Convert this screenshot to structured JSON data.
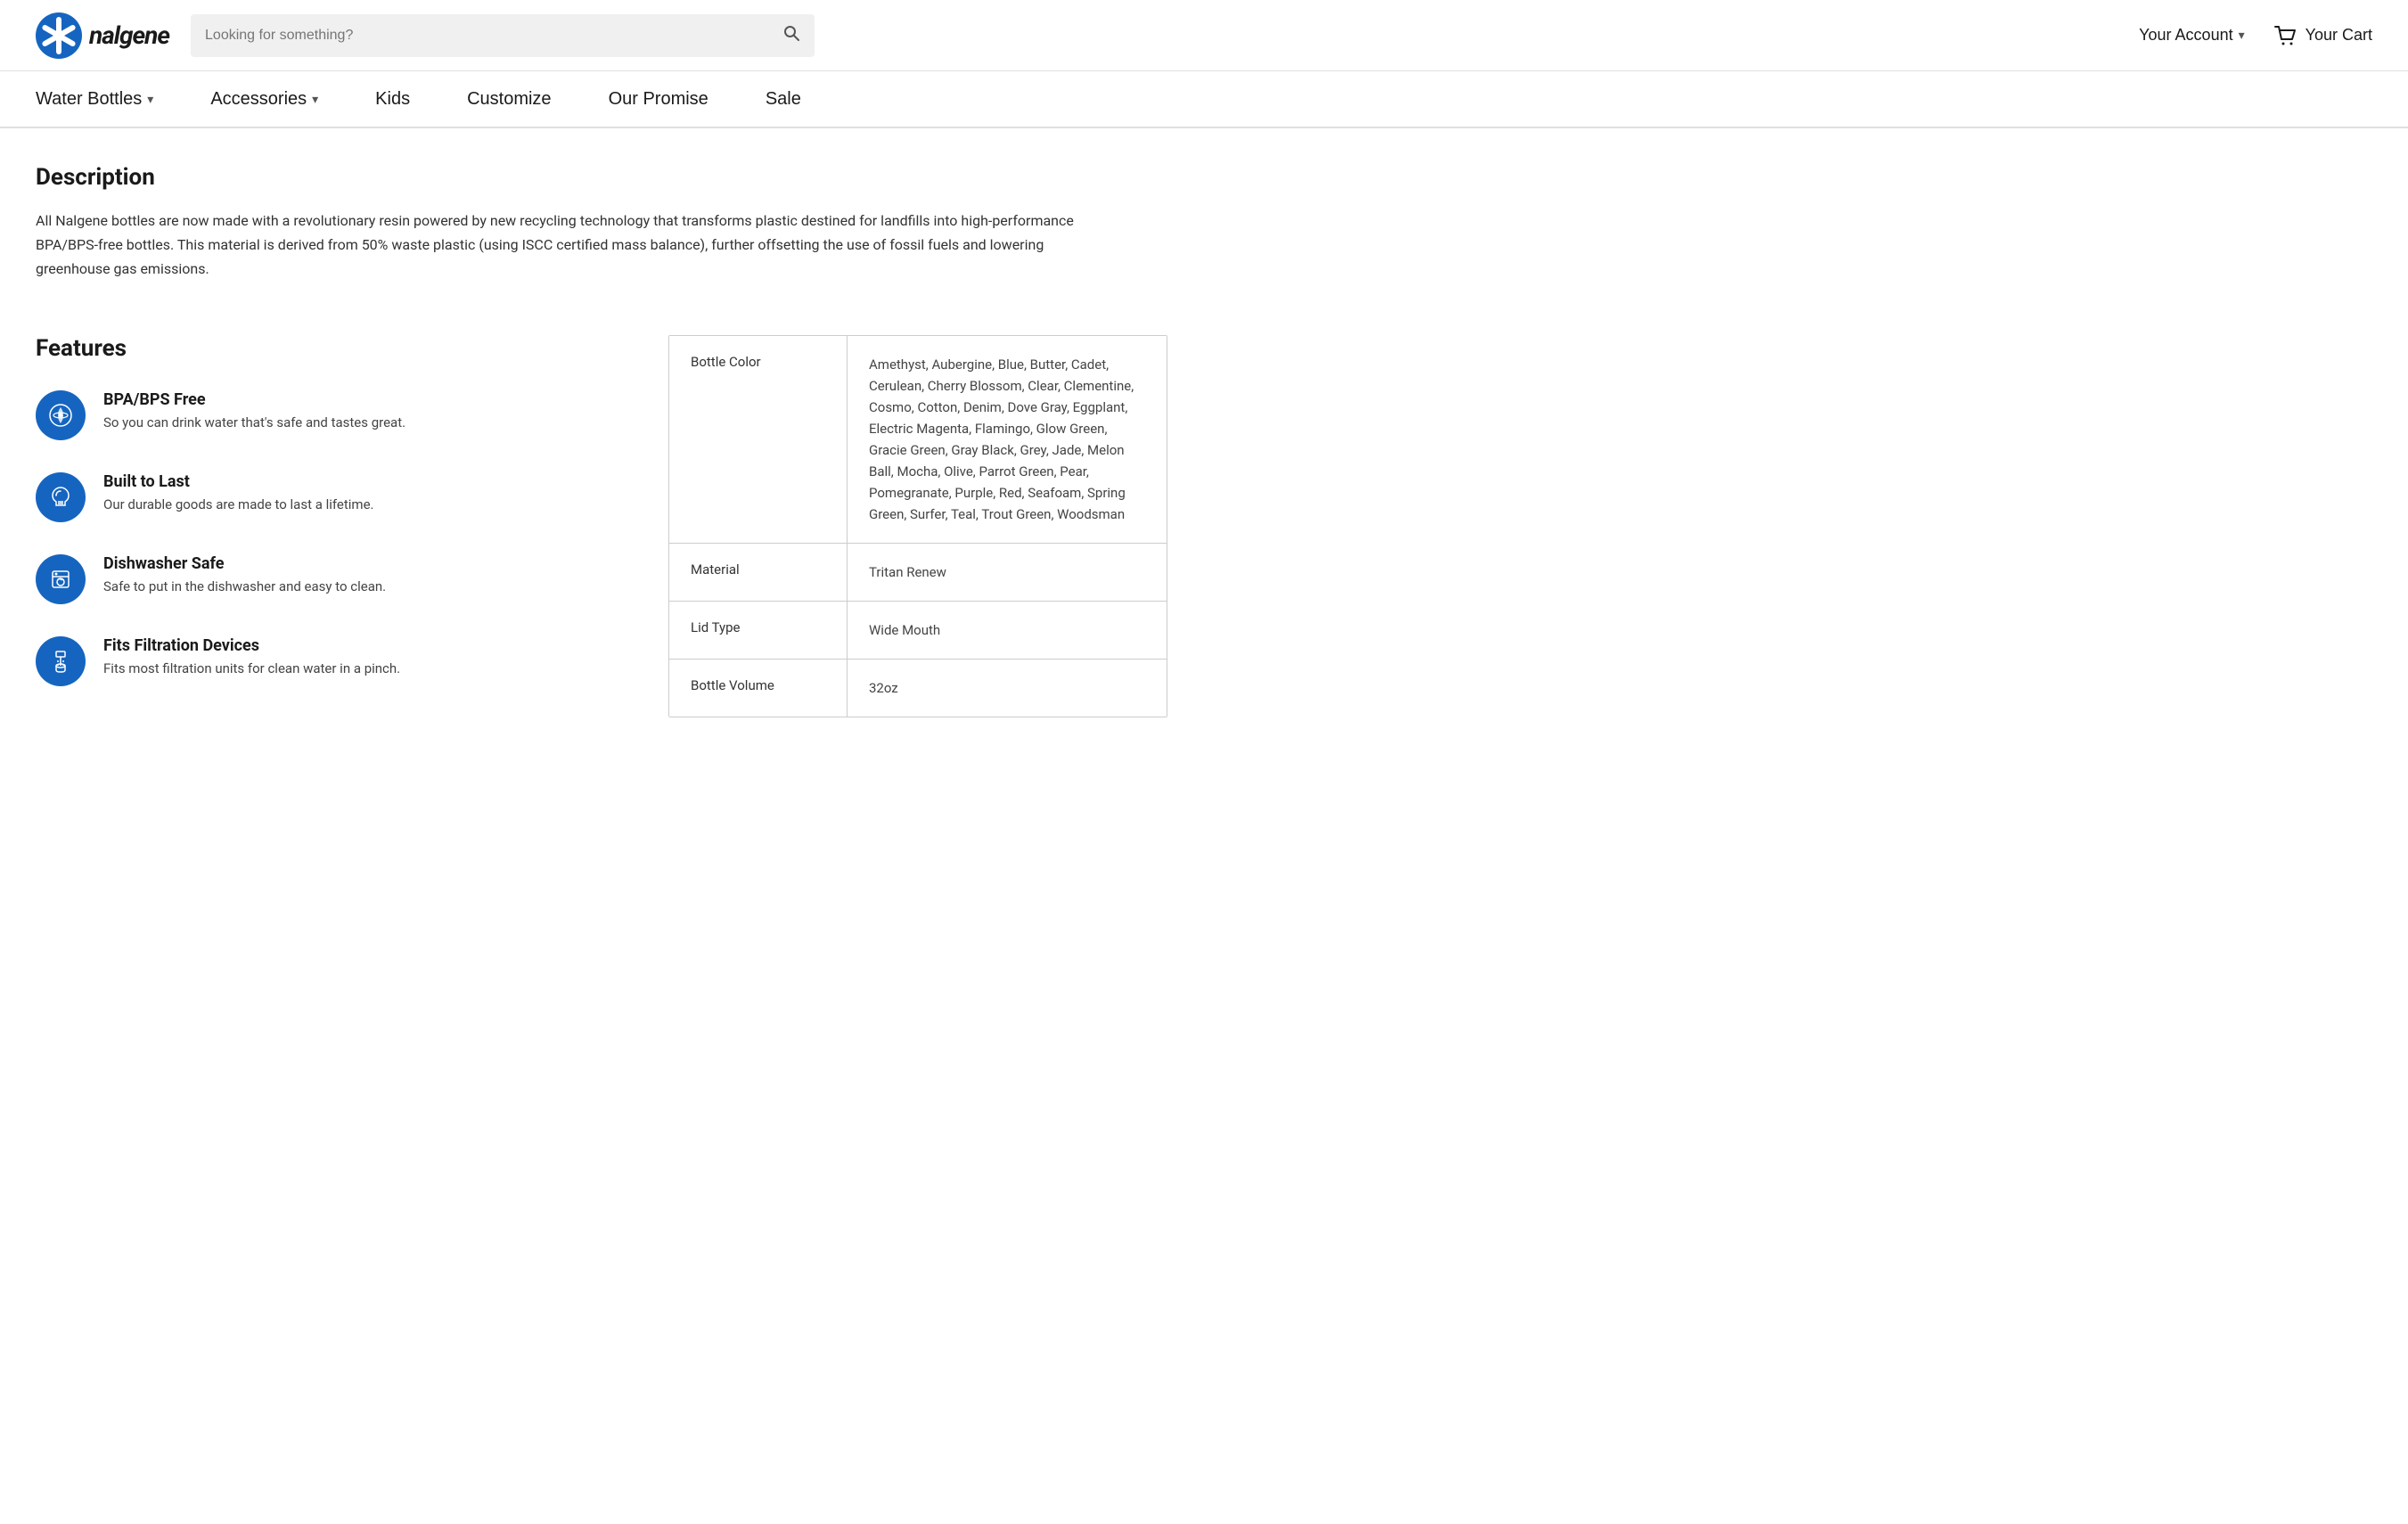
{
  "header": {
    "logo_text": "nalgene",
    "search_placeholder": "Looking for something?",
    "account_label": "Your Account",
    "cart_label": "Your Cart"
  },
  "nav": {
    "items": [
      {
        "label": "Water Bottles",
        "has_dropdown": true
      },
      {
        "label": "Accessories",
        "has_dropdown": true
      },
      {
        "label": "Kids",
        "has_dropdown": false
      },
      {
        "label": "Customize",
        "has_dropdown": false
      },
      {
        "label": "Our Promise",
        "has_dropdown": false
      },
      {
        "label": "Sale",
        "has_dropdown": false
      }
    ]
  },
  "description": {
    "title": "Description",
    "text": "All Nalgene bottles are now made with a revolutionary resin powered by new recycling technology that transforms plastic destined for landfills into high-performance BPA/BPS-free bottles. This material is derived from 50% waste plastic (using ISCC certified mass balance), further offsetting the use of fossil fuels and lowering greenhouse gas emissions."
  },
  "features": {
    "title": "Features",
    "items": [
      {
        "id": "bpa-bps-free",
        "name": "BPA/BPS Free",
        "description": "So you can drink water that's safe and tastes great."
      },
      {
        "id": "built-to-last",
        "name": "Built to Last",
        "description": "Our durable goods are made to last a lifetime."
      },
      {
        "id": "dishwasher-safe",
        "name": "Dishwasher Safe",
        "description": "Safe to put in the dishwasher and easy to clean."
      },
      {
        "id": "fits-filtration",
        "name": "Fits Filtration Devices",
        "description": "Fits most filtration units for clean water in a pinch."
      }
    ]
  },
  "specs": {
    "rows": [
      {
        "label": "Bottle Color",
        "value": "Amethyst, Aubergine, Blue, Butter, Cadet, Cerulean, Cherry Blossom, Clear, Clementine, Cosmo, Cotton, Denim, Dove Gray, Eggplant, Electric Magenta, Flamingo, Glow Green, Gracie Green, Gray Black, Grey, Jade, Melon Ball, Mocha, Olive, Parrot Green, Pear, Pomegranate, Purple, Red, Seafoam, Spring Green, Surfer, Teal, Trout Green, Woodsman"
      },
      {
        "label": "Material",
        "value": "Tritan Renew"
      },
      {
        "label": "Lid Type",
        "value": "Wide Mouth"
      },
      {
        "label": "Bottle Volume",
        "value": "32oz"
      }
    ]
  }
}
